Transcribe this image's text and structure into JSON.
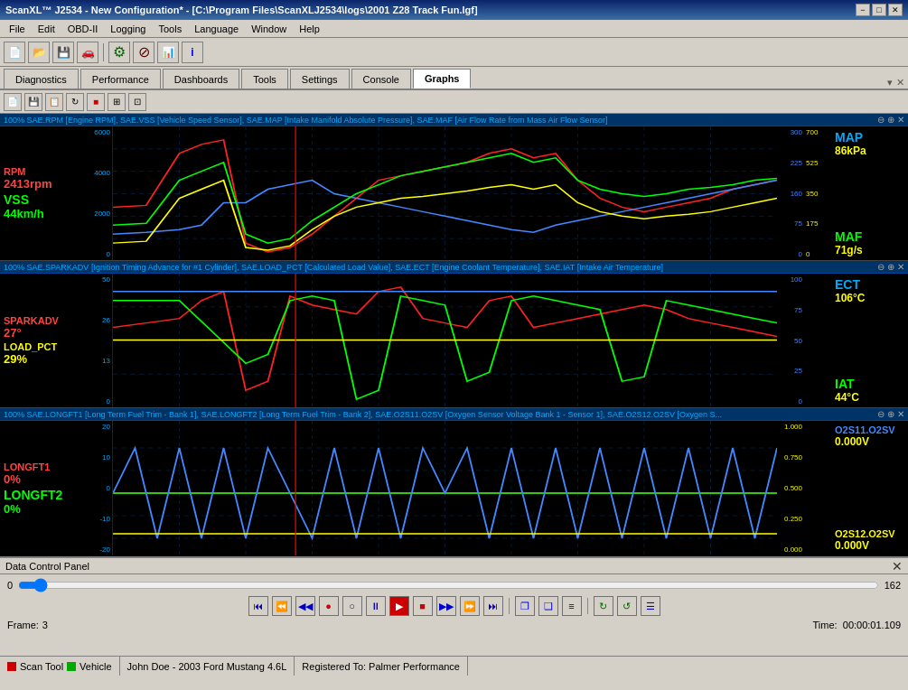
{
  "window": {
    "title": "ScanXL™ J2534 - New Configuration* - [C:\\Program Files\\ScanXLJ2534\\logs\\2001 Z28 Track Fun.lgf]",
    "min_label": "−",
    "max_label": "□",
    "close_label": "✕"
  },
  "menu": {
    "items": [
      "File",
      "Edit",
      "OBD-II",
      "Logging",
      "Tools",
      "Language",
      "Window",
      "Help"
    ]
  },
  "tabs": {
    "items": [
      "Diagnostics",
      "Performance",
      "Dashboards",
      "Tools",
      "Settings",
      "Console",
      "Graphs"
    ],
    "active": "Graphs"
  },
  "graphs": {
    "panel1": {
      "header": "100% SAE.RPM [Engine RPM], SAE.VSS [Vehicle Speed Sensor], SAE.MAP [Intake Manifold Absolute Pressure], SAE.MAF [Air Flow Rate from Mass Air Flow Sensor]",
      "labels_left": {
        "rpm_name": "RPM",
        "rpm_val": "2413rpm",
        "vss_name": "VSS",
        "vss_val": "44km/h"
      },
      "labels_right": {
        "map_name": "MAP",
        "map_val": "86kPa",
        "maf_name": "MAF",
        "maf_val": "71g/s"
      },
      "y_left_ticks": [
        "6000",
        "4000",
        "2000",
        "0"
      ],
      "y_right_ticks_blue": [
        "300",
        "225",
        "160",
        "75",
        "0"
      ],
      "y_right_ticks_yellow": [
        "700",
        "525",
        "350",
        "175",
        "0"
      ]
    },
    "panel2": {
      "header": "100% SAE.SPARKADV [Ignition Timing Advance for #1 Cylinder], SAE.LOAD_PCT [Calculated Load Value], SAE.ECT [Engine Coolant Temperature], SAE.IAT [Intake Air Temperature]",
      "labels_left": {
        "spark_name": "SPARKADV",
        "spark_val": "27°",
        "load_name": "LOAD_PCT",
        "load_val": "29%"
      },
      "labels_right": {
        "ect_name": "ECT",
        "ect_val": "106°C",
        "iat_name": "IAT",
        "iat_val": "44°C"
      },
      "y_left_ticks": [
        "50",
        "26",
        "13",
        "0"
      ],
      "y_right_ticks": [
        "100",
        "75",
        "50",
        "25",
        "0"
      ]
    },
    "panel3": {
      "header": "100% SAE.LONGFT1 [Long Term Fuel Trim - Bank 1], SAE.LONGFT2 [Long Term Fuel Trim - Bank 2], SAE.O2S11.O2SV [Oxygen Sensor Voltage Bank 1 - Sensor 1], SAE.O2S12.O2SV [Oxygen S...",
      "labels_left": {
        "longft1_name": "LONGFT1",
        "longft1_val": "0%",
        "longft2_name": "LONGFT2",
        "longft2_val": "0%"
      },
      "labels_right": {
        "o2s11_name": "O2S11.O2SV",
        "o2s11_val": "0.000V",
        "o2s12_name": "O2S12.O2SV",
        "o2s12_val": "0.000V"
      },
      "y_left_ticks": [
        "20",
        "10",
        "0",
        "-10",
        "-20"
      ],
      "y_right_ticks": [
        "1.000",
        "0.750",
        "0.500",
        "0.250",
        "0.000"
      ]
    }
  },
  "control_panel": {
    "title": "Data Control Panel",
    "close_label": "✕",
    "slider_min": "0",
    "slider_max": "162",
    "slider_val": 3,
    "frame_label": "Frame:",
    "frame_val": "3",
    "time_label": "Time:",
    "time_val": "00:00:01.109",
    "buttons": [
      "⏮",
      "⏪",
      "◄◄",
      "●",
      "○",
      "⏸",
      "▶",
      "⏹",
      "▶▶",
      "⏩",
      "⏭",
      "❐",
      "❑",
      "≡",
      "↻",
      "↺",
      "☰"
    ]
  },
  "status_bar": {
    "scan_tool_label": "Scan Tool",
    "vehicle_label": "Vehicle",
    "user_info": "John Doe  -  2003 Ford Mustang 4.6L",
    "registration": "Registered To: Palmer Performance"
  }
}
